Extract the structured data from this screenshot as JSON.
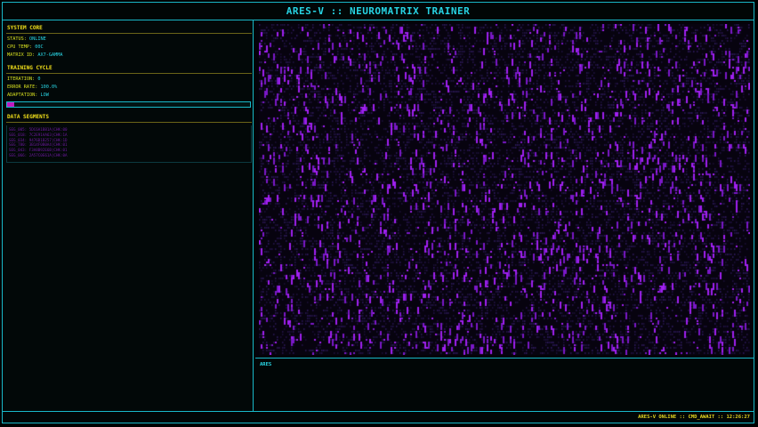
{
  "window": {
    "title": "ARES-V :: NEUROMATRIX TRAINER"
  },
  "system_core": {
    "header": "SYSTEM CORE",
    "status_label": "STATUS:",
    "status_value": "ONLINE",
    "cpu_label": "CPU TEMP:",
    "cpu_value": "00C",
    "matrix_label": "MATRIX ID:",
    "matrix_value": "AX7-GAMMA"
  },
  "training_cycle": {
    "header": "TRAINING CYCLE",
    "iteration_label": "ITERATION:",
    "iteration_value": "0",
    "error_label": "ERROR RATE:",
    "error_value": "100.0%",
    "adaptation_label": "ADAPTATION:",
    "adaptation_value": "LOW",
    "progress_fraction": 0.03
  },
  "data_segments": {
    "header": "DATA SEGMENTS",
    "lines": [
      "SEG_005: 5DC6A1B81A|CHK:00",
      "SEG_018: 7C2E91AA63|CHK:1A",
      "SEG_034: 9476D1B257|CHK:1D",
      "SEG_780: 3B14F0B0A4|CHK:01",
      "SEG_043: F3A8B92E6B|CHK:01",
      "SEG_066: 2A57C0E61A|CHK:0A"
    ]
  },
  "console": {
    "label": "ARES"
  },
  "statusbar": {
    "text": "ARES-V ONLINE :: CMD_AWAIT :: 12:26:27"
  },
  "colors": {
    "frame": "#19b8c8",
    "accent_cyan": "#29d7e6",
    "header_yellow": "#f2e01a",
    "matrix_purple": "#9b22e0",
    "progress_magenta": "#c01ac0"
  }
}
